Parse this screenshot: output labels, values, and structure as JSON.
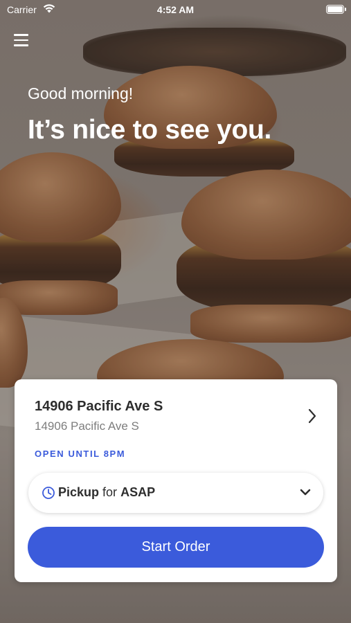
{
  "status_bar": {
    "carrier": "Carrier",
    "time": "4:52 AM"
  },
  "icons": {
    "menu": "hamburger-menu-icon",
    "wifi": "wifi-icon",
    "battery": "battery-icon",
    "location_chevron": "chevron-right-icon",
    "time": "clock-icon",
    "dropdown": "chevron-down-icon"
  },
  "hero": {
    "greeting": "Good morning!",
    "headline": "It’s nice to see you."
  },
  "location_card": {
    "name": "14906 Pacific Ave S",
    "address": "14906 Pacific Ave S",
    "hours": "OPEN UNTIL 8PM",
    "order_mode": "Pickup",
    "for_label": "for",
    "order_time": "ASAP",
    "start_button": "Start Order"
  },
  "colors": {
    "accent": "#3b5bdb",
    "text_dark": "#2d2d2d",
    "text_muted": "#7d7d7d"
  }
}
